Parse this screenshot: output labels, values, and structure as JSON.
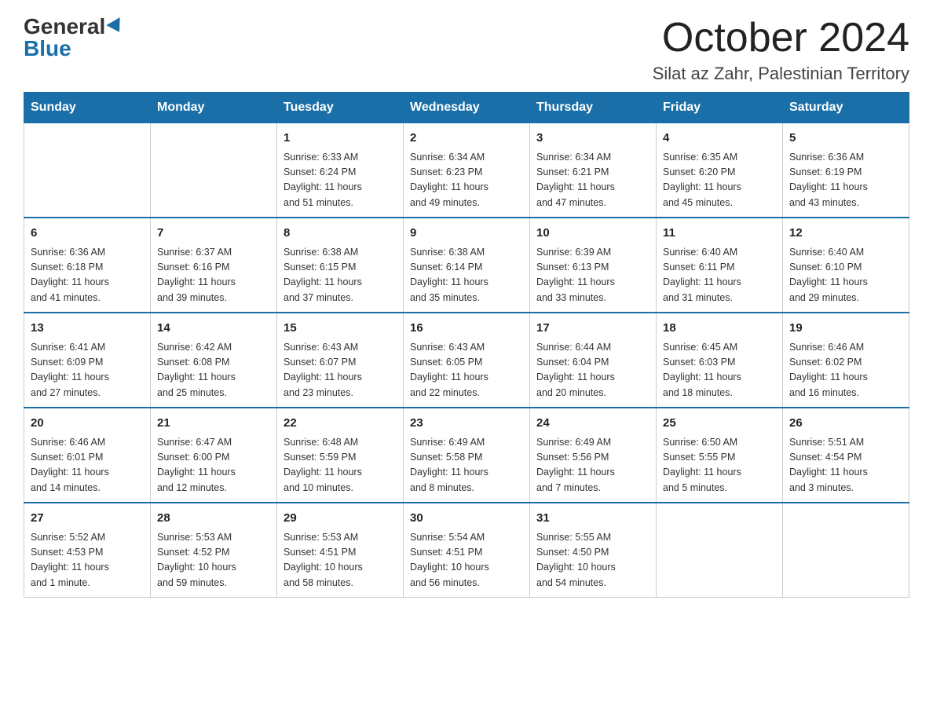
{
  "header": {
    "logo_general": "General",
    "logo_blue": "Blue",
    "title": "October 2024",
    "subtitle": "Silat az Zahr, Palestinian Territory"
  },
  "weekdays": [
    "Sunday",
    "Monday",
    "Tuesday",
    "Wednesday",
    "Thursday",
    "Friday",
    "Saturday"
  ],
  "weeks": [
    [
      {
        "day": "",
        "info": ""
      },
      {
        "day": "",
        "info": ""
      },
      {
        "day": "1",
        "info": "Sunrise: 6:33 AM\nSunset: 6:24 PM\nDaylight: 11 hours\nand 51 minutes."
      },
      {
        "day": "2",
        "info": "Sunrise: 6:34 AM\nSunset: 6:23 PM\nDaylight: 11 hours\nand 49 minutes."
      },
      {
        "day": "3",
        "info": "Sunrise: 6:34 AM\nSunset: 6:21 PM\nDaylight: 11 hours\nand 47 minutes."
      },
      {
        "day": "4",
        "info": "Sunrise: 6:35 AM\nSunset: 6:20 PM\nDaylight: 11 hours\nand 45 minutes."
      },
      {
        "day": "5",
        "info": "Sunrise: 6:36 AM\nSunset: 6:19 PM\nDaylight: 11 hours\nand 43 minutes."
      }
    ],
    [
      {
        "day": "6",
        "info": "Sunrise: 6:36 AM\nSunset: 6:18 PM\nDaylight: 11 hours\nand 41 minutes."
      },
      {
        "day": "7",
        "info": "Sunrise: 6:37 AM\nSunset: 6:16 PM\nDaylight: 11 hours\nand 39 minutes."
      },
      {
        "day": "8",
        "info": "Sunrise: 6:38 AM\nSunset: 6:15 PM\nDaylight: 11 hours\nand 37 minutes."
      },
      {
        "day": "9",
        "info": "Sunrise: 6:38 AM\nSunset: 6:14 PM\nDaylight: 11 hours\nand 35 minutes."
      },
      {
        "day": "10",
        "info": "Sunrise: 6:39 AM\nSunset: 6:13 PM\nDaylight: 11 hours\nand 33 minutes."
      },
      {
        "day": "11",
        "info": "Sunrise: 6:40 AM\nSunset: 6:11 PM\nDaylight: 11 hours\nand 31 minutes."
      },
      {
        "day": "12",
        "info": "Sunrise: 6:40 AM\nSunset: 6:10 PM\nDaylight: 11 hours\nand 29 minutes."
      }
    ],
    [
      {
        "day": "13",
        "info": "Sunrise: 6:41 AM\nSunset: 6:09 PM\nDaylight: 11 hours\nand 27 minutes."
      },
      {
        "day": "14",
        "info": "Sunrise: 6:42 AM\nSunset: 6:08 PM\nDaylight: 11 hours\nand 25 minutes."
      },
      {
        "day": "15",
        "info": "Sunrise: 6:43 AM\nSunset: 6:07 PM\nDaylight: 11 hours\nand 23 minutes."
      },
      {
        "day": "16",
        "info": "Sunrise: 6:43 AM\nSunset: 6:05 PM\nDaylight: 11 hours\nand 22 minutes."
      },
      {
        "day": "17",
        "info": "Sunrise: 6:44 AM\nSunset: 6:04 PM\nDaylight: 11 hours\nand 20 minutes."
      },
      {
        "day": "18",
        "info": "Sunrise: 6:45 AM\nSunset: 6:03 PM\nDaylight: 11 hours\nand 18 minutes."
      },
      {
        "day": "19",
        "info": "Sunrise: 6:46 AM\nSunset: 6:02 PM\nDaylight: 11 hours\nand 16 minutes."
      }
    ],
    [
      {
        "day": "20",
        "info": "Sunrise: 6:46 AM\nSunset: 6:01 PM\nDaylight: 11 hours\nand 14 minutes."
      },
      {
        "day": "21",
        "info": "Sunrise: 6:47 AM\nSunset: 6:00 PM\nDaylight: 11 hours\nand 12 minutes."
      },
      {
        "day": "22",
        "info": "Sunrise: 6:48 AM\nSunset: 5:59 PM\nDaylight: 11 hours\nand 10 minutes."
      },
      {
        "day": "23",
        "info": "Sunrise: 6:49 AM\nSunset: 5:58 PM\nDaylight: 11 hours\nand 8 minutes."
      },
      {
        "day": "24",
        "info": "Sunrise: 6:49 AM\nSunset: 5:56 PM\nDaylight: 11 hours\nand 7 minutes."
      },
      {
        "day": "25",
        "info": "Sunrise: 6:50 AM\nSunset: 5:55 PM\nDaylight: 11 hours\nand 5 minutes."
      },
      {
        "day": "26",
        "info": "Sunrise: 5:51 AM\nSunset: 4:54 PM\nDaylight: 11 hours\nand 3 minutes."
      }
    ],
    [
      {
        "day": "27",
        "info": "Sunrise: 5:52 AM\nSunset: 4:53 PM\nDaylight: 11 hours\nand 1 minute."
      },
      {
        "day": "28",
        "info": "Sunrise: 5:53 AM\nSunset: 4:52 PM\nDaylight: 10 hours\nand 59 minutes."
      },
      {
        "day": "29",
        "info": "Sunrise: 5:53 AM\nSunset: 4:51 PM\nDaylight: 10 hours\nand 58 minutes."
      },
      {
        "day": "30",
        "info": "Sunrise: 5:54 AM\nSunset: 4:51 PM\nDaylight: 10 hours\nand 56 minutes."
      },
      {
        "day": "31",
        "info": "Sunrise: 5:55 AM\nSunset: 4:50 PM\nDaylight: 10 hours\nand 54 minutes."
      },
      {
        "day": "",
        "info": ""
      },
      {
        "day": "",
        "info": ""
      }
    ]
  ]
}
